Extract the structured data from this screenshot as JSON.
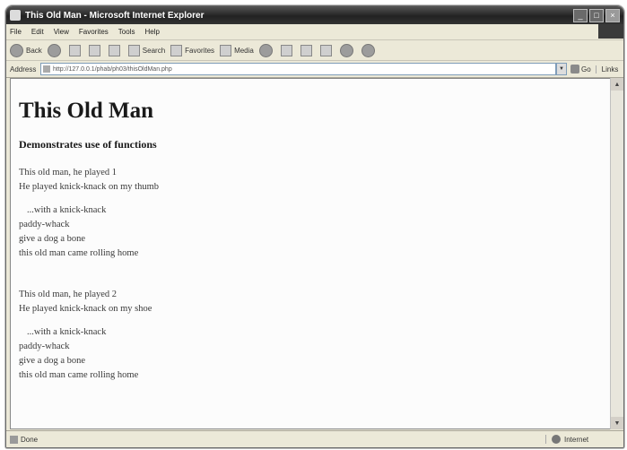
{
  "window": {
    "title": "This Old Man - Microsoft Internet Explorer"
  },
  "menu": [
    "File",
    "Edit",
    "View",
    "Favorites",
    "Tools",
    "Help"
  ],
  "toolbar": {
    "back": "Back",
    "search": "Search",
    "favorites": "Favorites",
    "media": "Media"
  },
  "address": {
    "label": "Address",
    "url": "http://127.0.0.1/phab/ph03/thisOldMan.php",
    "go": "Go",
    "links": "Links"
  },
  "page": {
    "heading": "This Old Man",
    "subheading": "Demonstrates use of functions",
    "verses": [
      {
        "line1": "This old man, he played 1",
        "line2": "He played knick-knack on my thumb",
        "chorus": [
          "...with a knick-knack",
          "paddy-whack",
          "give a dog a bone",
          "this old man came rolling home"
        ]
      },
      {
        "line1": "This old man, he played 2",
        "line2": "He played knick-knack on my shoe",
        "chorus": [
          "...with a knick-knack",
          "paddy-whack",
          "give a dog a bone",
          "this old man came rolling home"
        ]
      }
    ]
  },
  "status": {
    "text": "Done",
    "zone": "Internet"
  }
}
